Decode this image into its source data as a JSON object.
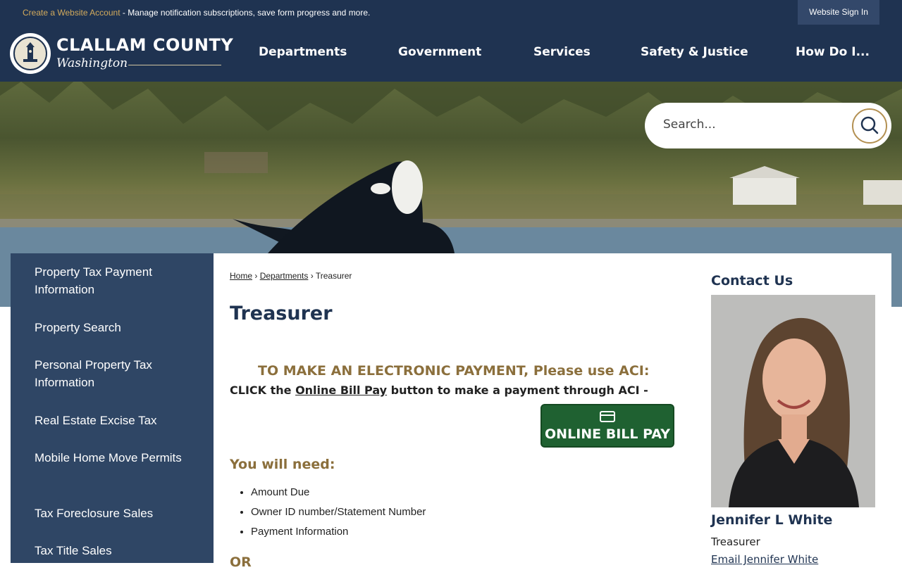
{
  "utility_bar": {
    "create_account_link": "Create a Website Account",
    "create_account_text": " - Manage notification subscriptions, save form progress and more.",
    "sign_in": "Website Sign In"
  },
  "brand": {
    "name": "CLALLAM COUNTY",
    "subtitle": "Washington"
  },
  "nav": {
    "items": [
      "Departments",
      "Government",
      "Services",
      "Safety & Justice",
      "How Do I..."
    ]
  },
  "search": {
    "placeholder": "Search..."
  },
  "sidebar": {
    "items": [
      "Property Tax Payment Information",
      "Property Search",
      "Personal Property Tax Information",
      "Real Estate Excise Tax",
      "Mobile Home Move Permits",
      "Tax Foreclosure Sales",
      "Tax Title Sales"
    ]
  },
  "breadcrumb": {
    "home": "Home",
    "sep1": " › ",
    "departments": "Departments",
    "sep2": " › ",
    "current": "Treasurer"
  },
  "page": {
    "title": "Treasurer",
    "aci_heading": "TO MAKE AN ELECTRONIC PAYMENT, Please use ACI:",
    "click_pre": "CLICK the ",
    "click_link": "Online Bill Pay",
    "click_post": " button to make a payment through ACI -",
    "bill_pay_button": "ONLINE BILL PAY",
    "need_heading": "You will need:",
    "needs": [
      "Amount Due",
      "Owner ID number/Statement Number",
      "Payment Information"
    ],
    "or_heading": "OR"
  },
  "contact": {
    "title": "Contact Us",
    "name": "Jennifer L White",
    "role": "Treasurer",
    "email": "Email Jennifer White"
  },
  "colors": {
    "navy": "#1f3351",
    "sidebar": "#2f4665",
    "gold": "#8b6f3c",
    "bill_pay_green": "#1f6131"
  }
}
